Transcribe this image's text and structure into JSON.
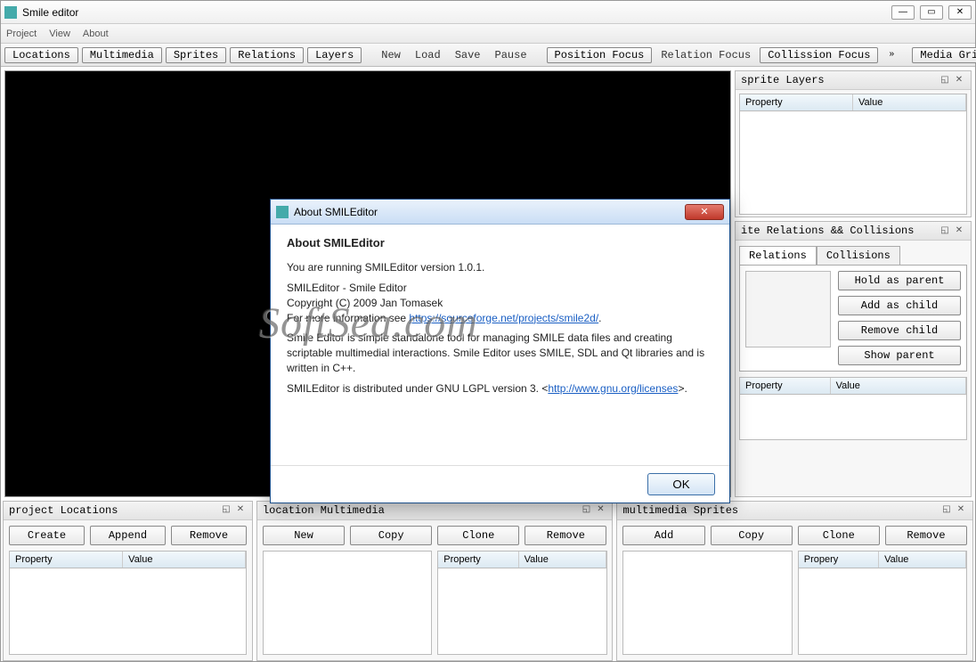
{
  "window": {
    "title": "Smile editor"
  },
  "menubar": [
    "Project",
    "View",
    "About"
  ],
  "toolbar": {
    "buttons": {
      "locations": "Locations",
      "multimedia": "Multimedia",
      "sprites": "Sprites",
      "relations": "Relations",
      "layers": "Layers"
    },
    "actions": {
      "new": "New",
      "load": "Load",
      "save": "Save",
      "pause": "Pause"
    },
    "focus": {
      "position": "Position Focus",
      "relation": "Relation Focus",
      "collision": "Collission Focus"
    },
    "media_grid": "Media Grid"
  },
  "panels": {
    "sprite_layers": {
      "title": "sprite Layers",
      "col_property": "Property",
      "col_value": "Value"
    },
    "relations": {
      "title": "ite Relations && Collisions",
      "tab_relations": "Relations",
      "tab_collisions": "Collisions",
      "btn_hold": "Hold as parent",
      "btn_add": "Add as child",
      "btn_remove": "Remove child",
      "btn_show": "Show parent",
      "col_property": "Property",
      "col_value": "Value"
    }
  },
  "bottom": {
    "locations": {
      "title": "project Locations",
      "btn1": "Create",
      "btn2": "Append",
      "btn3": "Remove",
      "col_property": "Property",
      "col_value": "Value"
    },
    "multimedia": {
      "title": "location Multimedia",
      "btn1": "New",
      "btn2": "Copy",
      "btn3": "Clone",
      "btn4": "Remove",
      "col_property": "Property",
      "col_value": "Value"
    },
    "sprites": {
      "title": "multimedia Sprites",
      "btn1": "Add",
      "btn2": "Copy",
      "btn3": "Clone",
      "btn4": "Remove",
      "col_property": "Propery",
      "col_value": "Value"
    }
  },
  "about": {
    "title": "About SMILEditor",
    "heading": "About SMILEditor",
    "p1": "You are running SMILEditor version 1.0.1.",
    "p2a": "SMILEditor - Smile Editor",
    "p2b": "Copyright (C) 2009 Jan Tomasek",
    "p2c_pre": "For more information see ",
    "p2c_link": "https://sourceforge.net/projects/smile2d/",
    "p3": "Smile Editor is simple standalone tool for managing SMILE data files and creating scriptable multimedial interactions. Smile Editor uses SMILE, SDL and Qt libraries and is written in C++.",
    "p4_pre": "SMILEditor is distributed under GNU LGPL version 3. <",
    "p4_link": "http://www.gnu.org/licenses",
    "p4_post": ">.",
    "ok": "OK"
  },
  "watermark": "SoftSea.com"
}
